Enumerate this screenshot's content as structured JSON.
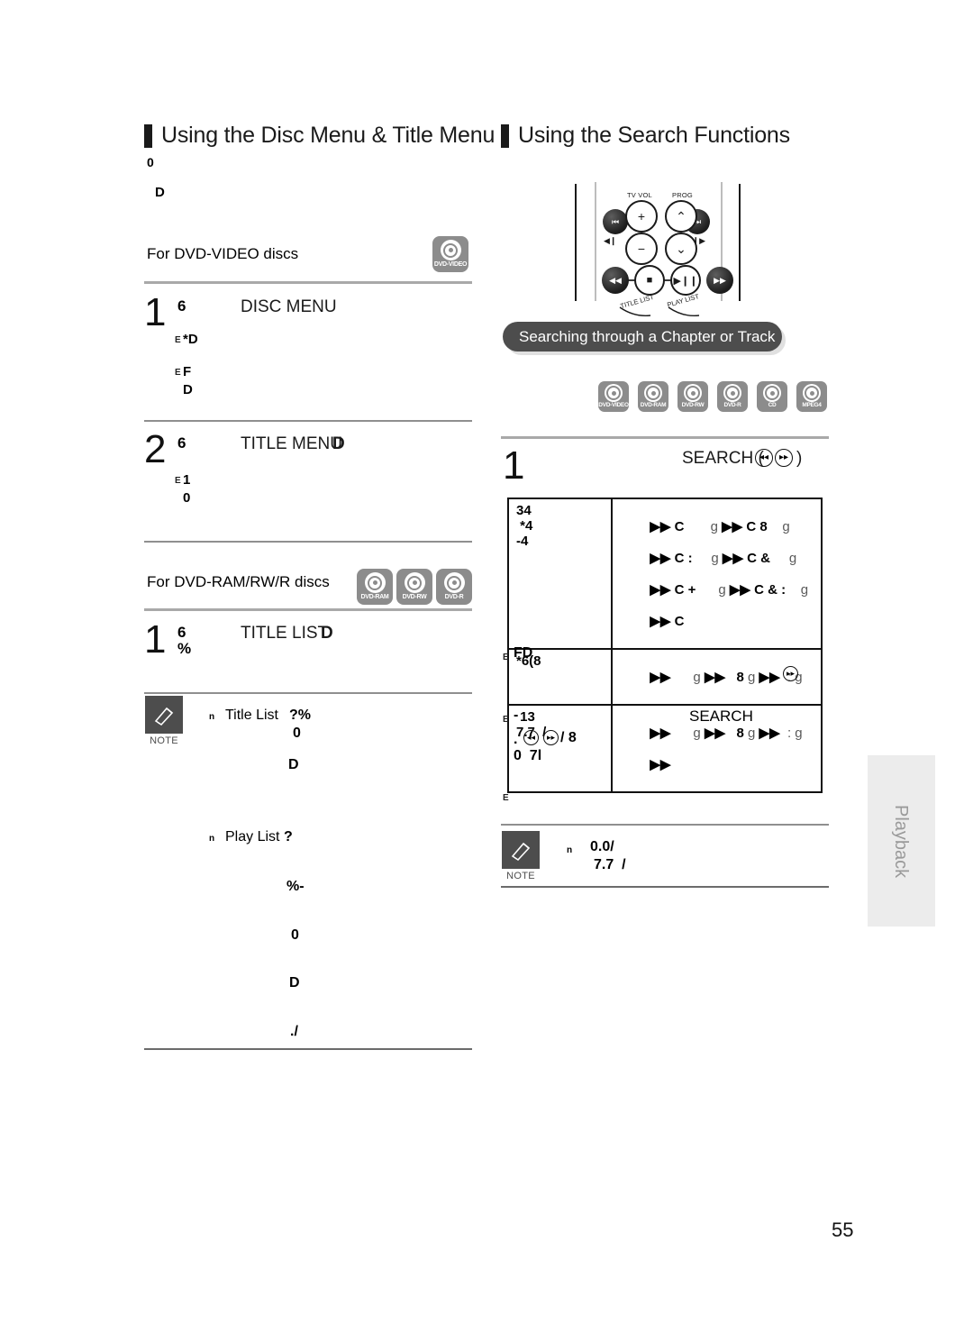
{
  "page": {
    "number": "55",
    "side_tab_label": "Playback"
  },
  "left_column": {
    "heading": "Using the Disc Menu & Title Menu",
    "intro_glyph_1": "0",
    "intro_glyph_2": "D",
    "subhead_dvd_video": "For DVD-VIDEO discs",
    "dvd_video_icon_label": "DVD-VIDEO",
    "steps": [
      {
        "number": "1",
        "marker": "6",
        "title": "DISC MENU",
        "sub_lines": [
          {
            "prefix": "E",
            "text": "*D"
          },
          {
            "prefix": "E",
            "text": "F"
          },
          {
            "prefix": "",
            "text": "D"
          }
        ]
      },
      {
        "number": "2",
        "marker": "6",
        "title": "TITLE MENU",
        "title_suffix": "D",
        "sub_lines": [
          {
            "prefix": "E",
            "text": "1"
          },
          {
            "prefix": "",
            "text": "0"
          }
        ]
      }
    ],
    "subhead_dvd_ram": "For DVD-RAM/RW/R discs",
    "ram_icon_labels": [
      "DVD-RAM",
      "DVD-RW",
      "DVD-R"
    ],
    "step_title_list": {
      "number": "1",
      "marker": "6",
      "marker2": "%",
      "title": "TITLE LIST",
      "title_suffix": "D"
    },
    "note": {
      "word": "NOTE",
      "bullets": [
        {
          "bullet": "n",
          "label": "Title List",
          "value": "?%"
        },
        {
          "bullet": "",
          "label": "",
          "value": "0"
        },
        {
          "bullet": "",
          "label": "",
          "value": "D"
        },
        {
          "bullet": "n",
          "label": "Play List",
          "value": "?"
        },
        {
          "bullet": "",
          "label": "",
          "value": "%-"
        },
        {
          "bullet": "",
          "label": "",
          "value": "0"
        },
        {
          "bullet": "",
          "label": "",
          "value": "D"
        },
        {
          "bullet": "",
          "label": "",
          "value": "./"
        }
      ]
    }
  },
  "right_column": {
    "heading": "Using the Search Functions",
    "remote": {
      "tv_vol_label": "TV VOL",
      "prog_label": "PROG",
      "plus_label": "+",
      "minus_label": "−",
      "up_label": "⌃",
      "down_label": "⌄",
      "prev_label": "⏮",
      "next_label": "⏭",
      "rew_label": "◀◀",
      "ffwd_label": "▶▶",
      "stop_label": "■",
      "play_pause_label": "▶❙❙",
      "step_back_label": "◀❙",
      "step_fwd_label": "❙❙▶",
      "title_list_label": "TITLE LIST",
      "play_list_label": "PLAY LIST"
    },
    "banner": "Searching through a Chapter or Track",
    "disc_icons": [
      "DVD-VIDEO",
      "DVD-RAM",
      "DVD-RW",
      "DVD-R",
      "CD",
      "MPEG4"
    ],
    "step": {
      "number": "1",
      "title": "SEARCH (",
      "title_close": ")"
    },
    "table": {
      "rows": [
        {
          "col1": [
            "34",
            " *4",
            "-4"
          ],
          "col2": [
            [
              {
                "a": "▶▶",
                "t": "C"
              },
              {
                "g": "g"
              },
              {
                "a": "▶▶",
                "t": "C 8"
              },
              {
                "g": "g"
              }
            ],
            [
              {
                "a": "▶▶",
                "t": "C :"
              },
              {
                "g": "g"
              },
              {
                "a": "▶▶",
                "t": "C &"
              },
              {
                "g": "g"
              }
            ],
            [
              {
                "a": "▶▶",
                "t": "C +"
              },
              {
                "g": "g"
              },
              {
                "a": "▶▶",
                "t": "C & :"
              },
              {
                "g": "g"
              }
            ],
            [
              {
                "a": "▶▶",
                "t": "C"
              }
            ]
          ]
        },
        {
          "col1": [
            "*6(8"
          ],
          "col2": [
            [
              {
                "a": "▶▶",
                "t": ""
              },
              {
                "g": "g"
              },
              {
                "a": "▶▶",
                "t": "8"
              },
              {
                "g": "g"
              },
              {
                "a": "▶▶",
                "t": ":"
              },
              {
                "g": "g"
              }
            ]
          ]
        },
        {
          "col1": [
            " 13",
            "7.7  /"
          ],
          "col2": [
            [
              {
                "a": "▶▶",
                "t": ""
              },
              {
                "g": "g"
              },
              {
                "a": "▶▶",
                "t": "8"
              },
              {
                "g": "g"
              },
              {
                "a": "▶▶",
                "t": ":"
              },
              {
                "g": "g"
              }
            ],
            [
              {
                "a": "▶▶",
                "t": ""
              }
            ]
          ]
        }
      ]
    },
    "below_table": [
      {
        "prefix": "E",
        "text": "FD"
      },
      {
        "prefix": "E",
        "text": "-"
      },
      {
        "prefix": "",
        "text": ". "
      },
      {
        "prefix": "",
        "text": "/ 8"
      },
      {
        "prefix": "",
        "text": "0  7l"
      },
      {
        "prefix": "E",
        "text": ""
      }
    ],
    "search_word": "SEARCH",
    "note": {
      "word": "NOTE",
      "bullets": [
        {
          "bullet": "n",
          "value": "0.0/"
        },
        {
          "bullet": "",
          "value": "7.7  /"
        }
      ]
    }
  },
  "colors": {
    "heading_bar": "#1a1a1a",
    "banner_bg": "#4d4d4d",
    "disc_icon_bg": "#8c8c8c",
    "note_icon_bg": "#4d4d4d",
    "side_tab_bg": "#ececec",
    "rule": "#8f8f8f"
  }
}
